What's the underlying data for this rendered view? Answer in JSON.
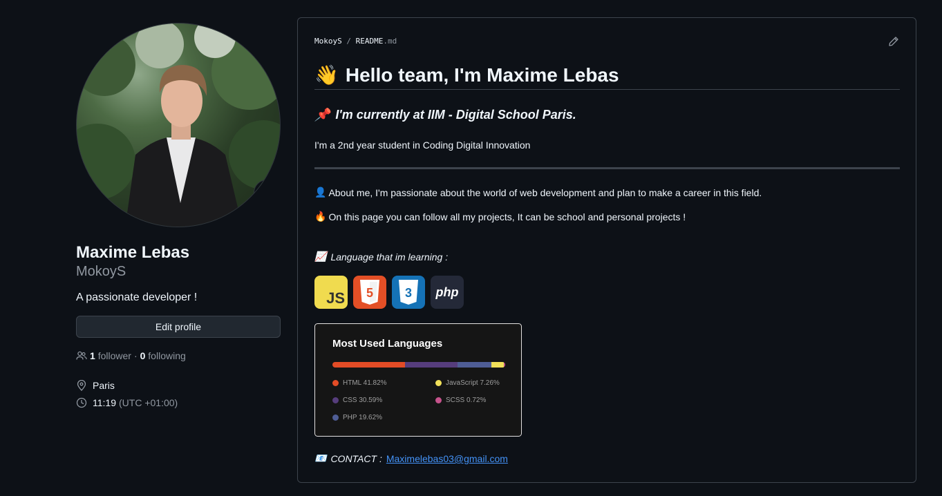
{
  "profile": {
    "fullname": "Maxime Lebas",
    "username": "MokoyS",
    "bio": "A passionate developer !",
    "edit_button": "Edit profile",
    "followers_count": "1",
    "followers_label": "follower",
    "separator": "·",
    "following_count": "0",
    "following_label": "following",
    "location": "Paris",
    "local_time": "11:19",
    "timezone": "(UTC +01:00)"
  },
  "readme": {
    "breadcrumb_user": "MokoyS",
    "breadcrumb_sep": "/",
    "breadcrumb_file": "README",
    "breadcrumb_ext": ".md",
    "heading_emoji": "👋",
    "heading": "Hello team, I'm Maxime Lebas",
    "subheading_emoji": "📌",
    "subheading": "I'm currently at IIM - Digital School Paris.",
    "student_line": "I'm a 2nd year student in Coding Digital Innovation",
    "about_emoji": "👤",
    "about": "About me, I'm passionate about the world of web development and plan to make a career in this field.",
    "projects_emoji": "🔥",
    "projects": "On this page you can follow all my projects, It can be school and personal projects !",
    "learning_emoji": "📈",
    "learning": "Language that im learning :",
    "language_icons": [
      {
        "name": "javascript-icon",
        "text": "JS"
      },
      {
        "name": "html5-icon",
        "text": "5"
      },
      {
        "name": "css3-icon",
        "text": "3"
      },
      {
        "name": "php-icon",
        "text": "php"
      }
    ],
    "contact_emoji": "📧",
    "contact_label": "CONTACT :",
    "contact_email": "Maximelebas03@gmail.com"
  },
  "chart_data": {
    "type": "bar",
    "title": "Most Used Languages",
    "series": [
      {
        "name": "HTML",
        "value": 41.82,
        "label": "HTML 41.82%",
        "color": "#e34c26"
      },
      {
        "name": "CSS",
        "value": 30.59,
        "label": "CSS 30.59%",
        "color": "#563d7c"
      },
      {
        "name": "PHP",
        "value": 19.62,
        "label": "PHP 19.62%",
        "color": "#4f5d95"
      },
      {
        "name": "JavaScript",
        "value": 7.26,
        "label": "JavaScript 7.26%",
        "color": "#f1e05a"
      },
      {
        "name": "SCSS",
        "value": 0.72,
        "label": "SCSS 0.72%",
        "color": "#c6538c"
      }
    ]
  },
  "colors": {
    "background": "#0d1117",
    "border": "#3d444d",
    "link": "#4493f8",
    "text": "#f0f6fc",
    "muted": "#9198a1"
  }
}
